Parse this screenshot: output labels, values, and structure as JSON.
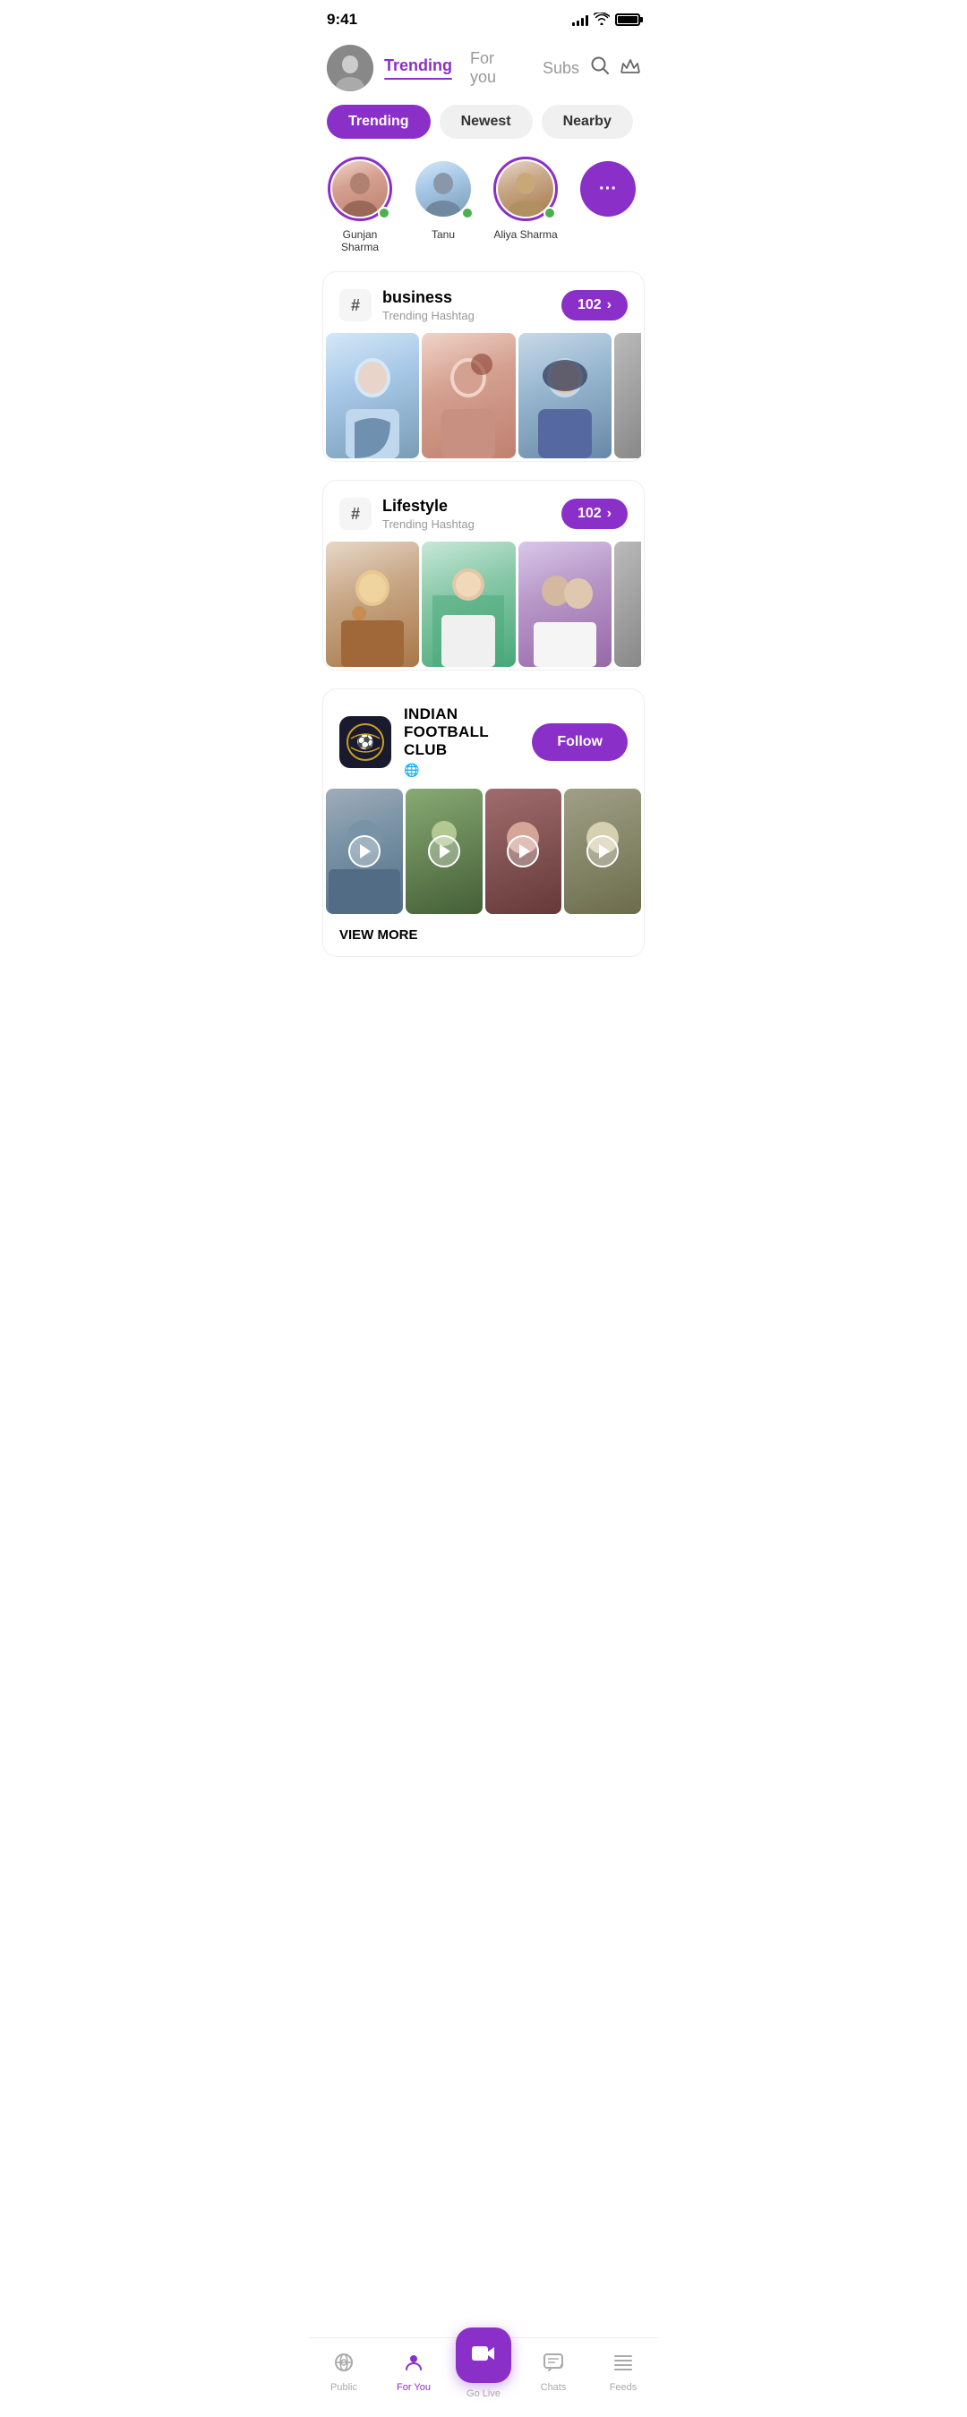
{
  "statusBar": {
    "time": "9:41",
    "signalBars": [
      4,
      6,
      9,
      12,
      14
    ],
    "batteryFull": true
  },
  "header": {
    "avatarEmoji": "👩",
    "navItems": [
      {
        "label": "Trending",
        "active": true
      },
      {
        "label": "For you",
        "active": false
      },
      {
        "label": "Subs",
        "active": false
      }
    ],
    "searchLabel": "search",
    "crownLabel": "crown"
  },
  "filterTabs": [
    {
      "label": "Trending",
      "active": true
    },
    {
      "label": "Newest",
      "active": false
    },
    {
      "label": "Nearby",
      "active": false
    }
  ],
  "stories": [
    {
      "name": "Gunjan Sharma",
      "emoji": "🧍",
      "hasRing": true,
      "online": true
    },
    {
      "name": "Tanu",
      "emoji": "💁",
      "hasRing": false,
      "online": true
    },
    {
      "name": "Aliya Sharma",
      "emoji": "👱",
      "hasRing": true,
      "online": true
    },
    {
      "name": "more",
      "emoji": "···",
      "hasRing": false,
      "online": false,
      "isPurple": true
    }
  ],
  "hashtagCards": [
    {
      "symbol": "#",
      "name": "business",
      "subtitle": "Trending Hashtag",
      "count": "102",
      "images": [
        "person-1",
        "person-2",
        "person-3",
        "person-4"
      ]
    },
    {
      "symbol": "#",
      "name": "Lifestyle",
      "subtitle": "Trending Hashtag",
      "count": "102",
      "images": [
        "person-5",
        "person-6",
        "person-7",
        "person-8"
      ]
    }
  ],
  "clubCard": {
    "logoEmoji": "⚽",
    "name": "INDIAN FOOTBALL CLUB",
    "typeEmoji": "🌐",
    "followLabel": "Follow",
    "viewMoreLabel": "VIEW MORE",
    "videos": [
      "person-3",
      "person-1",
      "person-7",
      "person-5"
    ]
  },
  "bottomNav": [
    {
      "label": "Public",
      "icon": "📻",
      "active": false
    },
    {
      "label": "For You",
      "icon": "👤",
      "active": true
    },
    {
      "label": "Go Live",
      "icon": "🎥",
      "isCenter": true
    },
    {
      "label": "Chats",
      "icon": "💬",
      "active": false
    },
    {
      "label": "Feeds",
      "icon": "☰",
      "active": false
    }
  ]
}
